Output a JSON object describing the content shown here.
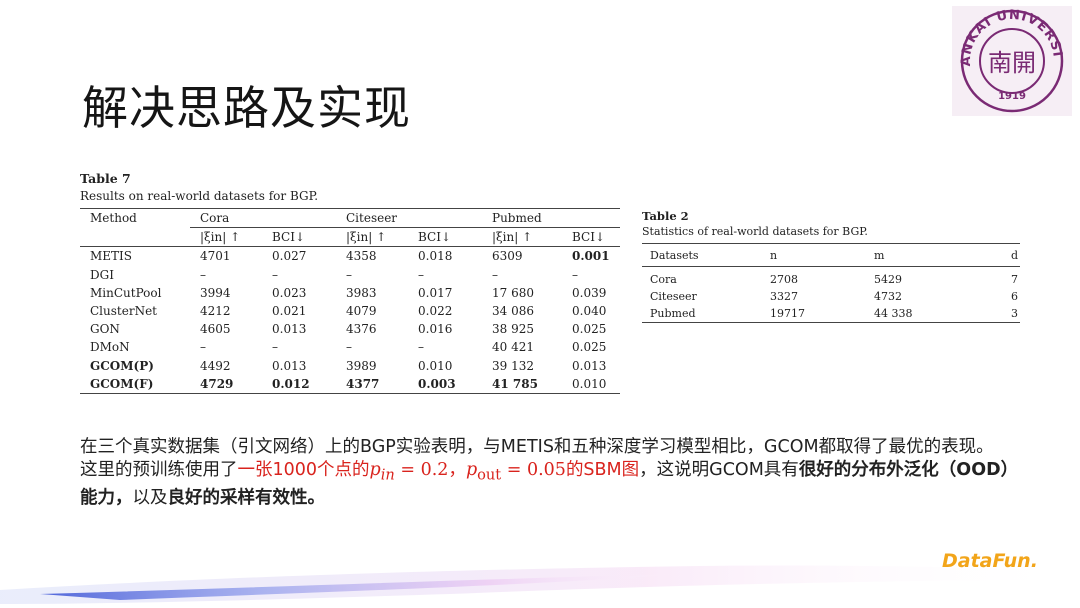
{
  "title": "解决思路及实现",
  "logo": {
    "top_text": "NANKAI UNIVERSITY",
    "year": "1919",
    "center": "南開",
    "color": "#7a2a74"
  },
  "table7": {
    "caption_num": "Table 7",
    "caption_text": "Results on real-world datasets for BGP.",
    "col_method": "Method",
    "groups": [
      "Cora",
      "Citeseer",
      "Pubmed"
    ],
    "sub_xi": "|ξin| ↑",
    "sub_bci": "BCI↓",
    "rows": [
      {
        "method": "METIS",
        "c1": "4701",
        "c2": "0.027",
        "s1": "4358",
        "s2": "0.018",
        "p1": "6309",
        "p2": "0.001"
      },
      {
        "method": "DGI",
        "c1": "–",
        "c2": "–",
        "s1": "–",
        "s2": "–",
        "p1": "–",
        "p2": "–"
      },
      {
        "method": "MinCutPool",
        "c1": "3994",
        "c2": "0.023",
        "s1": "3983",
        "s2": "0.017",
        "p1": "17 680",
        "p2": "0.039"
      },
      {
        "method": "ClusterNet",
        "c1": "4212",
        "c2": "0.021",
        "s1": "4079",
        "s2": "0.022",
        "p1": "34 086",
        "p2": "0.040"
      },
      {
        "method": "GON",
        "c1": "4605",
        "c2": "0.013",
        "s1": "4376",
        "s2": "0.016",
        "p1": "38 925",
        "p2": "0.025"
      },
      {
        "method": "DMoN",
        "c1": "–",
        "c2": "–",
        "s1": "–",
        "s2": "–",
        "p1": "40 421",
        "p2": "0.025"
      },
      {
        "method": "GCOM(P)",
        "c1": "4492",
        "c2": "0.013",
        "s1": "3989",
        "s2": "0.010",
        "p1": "39 132",
        "p2": "0.013"
      },
      {
        "method": "GCOM(F)",
        "c1": "4729",
        "c2": "0.012",
        "s1": "4377",
        "s2": "0.003",
        "p1": "41 785",
        "p2": "0.010"
      }
    ]
  },
  "table2": {
    "caption_num": "Table 2",
    "caption_text": "Statistics of real-world datasets for BGP.",
    "headers": [
      "Datasets",
      "n",
      "m",
      "d"
    ],
    "rows": [
      {
        "name": "Cora",
        "n": "2708",
        "m": "5429",
        "d": "7"
      },
      {
        "name": "Citeseer",
        "n": "3327",
        "m": "4732",
        "d": "6"
      },
      {
        "name": "Pubmed",
        "n": "19717",
        "m": "44 338",
        "d": "3"
      }
    ]
  },
  "body": {
    "para1": "在三个真实数据集（引文网络）上的BGP实验表明，与METIS和五种深度学习模型相比，GCOM都取得了最优的表现。",
    "para2_a": "这里的预训练使用了",
    "para2_red1": "一张1000个点的",
    "para2_math1": "p",
    "para2_math1_sub": "in",
    "para2_math1_val": " = 0.2，",
    "para2_math2": "p",
    "para2_math2_sub": "out",
    "para2_math2_val": " = 0.05",
    "para2_red2": "的SBM图",
    "para2_b": "，这说明GCOM具有",
    "para2_bold1": "很好的分布外泛化（OOD）能力，",
    "para2_c": "以及",
    "para2_bold2": "良好的采样有效性。"
  },
  "brand": "DataFun."
}
